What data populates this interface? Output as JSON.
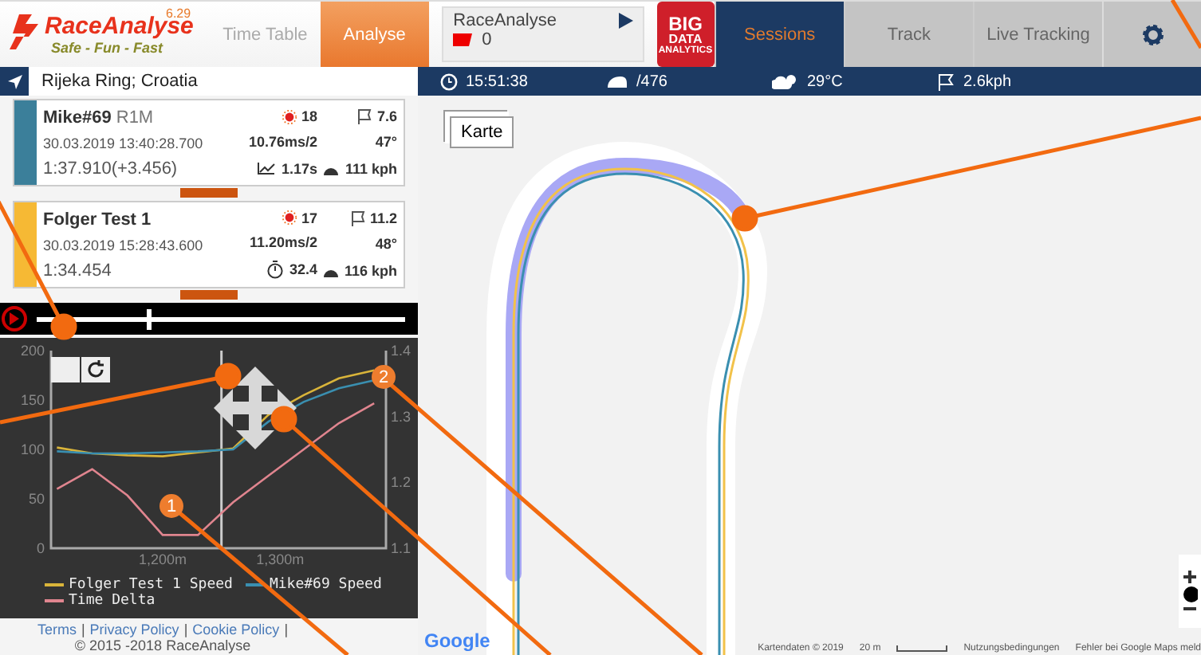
{
  "header": {
    "logo": {
      "name": "RaceAnalyse",
      "slogan": "Safe - Fun - Fast",
      "version": "6.29"
    },
    "nav_tabs": [
      {
        "label": "Time Table",
        "selected": false
      },
      {
        "label": "Analyse",
        "selected": true
      }
    ],
    "player_widget": {
      "title": "RaceAnalyse",
      "count": "0"
    },
    "big_data_logo": {
      "line_1": "BIG",
      "line_2": "DATA",
      "line_3": "ANALYTICS"
    },
    "section_tabs": [
      {
        "label": "Sessions",
        "selected": true
      },
      {
        "label": "Track",
        "selected": false
      },
      {
        "label": "Live Tracking",
        "selected": false
      }
    ]
  },
  "location": "Rijeka Ring; Croatia",
  "info_bar": [
    {
      "kind": "time",
      "text": "15:51:38"
    },
    {
      "kind": "helmet",
      "text": "/476"
    },
    {
      "kind": "weather",
      "text": "29°C"
    },
    {
      "kind": "wind",
      "text": "2.6kph"
    }
  ],
  "sessions": [
    {
      "driver": "Mike#69",
      "class": "R1M",
      "datetime": "30.03.2019 13:40:28.700",
      "laptime": "1:37.910(+3.456)",
      "accel": "10.76ms/2",
      "kind": "trend",
      "extra": "1.17s",
      "temp": "18",
      "flag": "7.6",
      "angle": "47°",
      "speed": "111 kph",
      "color": "#3b7f9a"
    },
    {
      "driver": "Folger Test 1",
      "datetime": "30.03.2019 15:28:43.600",
      "laptime": "1:34.454",
      "accel": "11.20ms/2",
      "kind": "stopwatch",
      "extra": "32.4",
      "temp": "17",
      "flag": "11.2",
      "angle": "48°",
      "speed": "116 kph",
      "color": "#f6b934"
    }
  ],
  "playback": {
    "level": 0.3
  },
  "chart_data": {
    "type": "line",
    "x": [
      1110,
      1140,
      1170,
      1200,
      1230,
      1260,
      1290,
      1320,
      1350,
      1380
    ],
    "xlim": [
      1105,
      1390
    ],
    "xticks": [
      {
        "value": 1200,
        "label": "1,200m"
      },
      {
        "value": 1300,
        "label": "1,300m"
      }
    ],
    "ylim": [
      0,
      200
    ],
    "yticks": [
      0,
      50,
      100,
      150,
      200
    ],
    "y2lim": [
      1.1,
      1.4
    ],
    "y2ticks": [
      1.1,
      1.2,
      1.3,
      1.4
    ],
    "ref_lines": [
      {
        "axis": "x",
        "value": 1250
      }
    ],
    "series": [
      {
        "name": "Folger Test 1 Speed",
        "color": "#d9b43a",
        "values": [
          102,
          96,
          94,
          93,
          97,
          101,
          135,
          155,
          172,
          180
        ]
      },
      {
        "name": "Mike#69 Speed",
        "color": "#3a8fb0",
        "values": [
          98,
          96,
          96,
          97,
          98,
          100,
          128,
          148,
          162,
          170
        ]
      },
      {
        "name": "Time Delta",
        "color": "#e0858f",
        "axis": "y2",
        "values": [
          1.19,
          1.22,
          1.18,
          1.12,
          1.12,
          1.17,
          1.21,
          1.25,
          1.29,
          1.32
        ]
      }
    ]
  },
  "footer": [
    {
      "kind": "link",
      "text": "Terms"
    },
    {
      "kind": "sep",
      "text": "|"
    },
    {
      "kind": "link",
      "text": "Privacy Policy"
    },
    {
      "kind": "sep",
      "text": "|"
    },
    {
      "kind": "link",
      "text": "Cookie Policy"
    },
    {
      "kind": "sep",
      "text": "|"
    },
    {
      "kind": "text",
      "text": "© 2015 -2018 RaceAnalyse"
    }
  ],
  "map": {
    "type_button": "Karte",
    "provider": "Google",
    "attribution": "Kartendaten © 2019",
    "scale": "20 m",
    "terms": "Nutzungsbedingungen",
    "report": "Fehler bei Google Maps meld"
  },
  "callouts": [
    "1",
    "2"
  ]
}
